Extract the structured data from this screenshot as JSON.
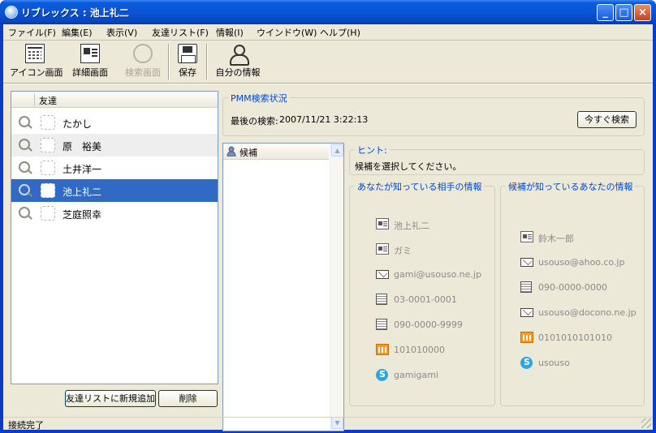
{
  "window": {
    "title": "リブレックス : 池上礼二",
    "min": "_",
    "max": "□",
    "close": "×"
  },
  "menu": [
    "ファイル(F)",
    "編集(E)",
    "表示(V)",
    "友達リスト(F)",
    "情報(I)",
    "ウインドウ(W)",
    "ヘルプ(H)"
  ],
  "toolbar": {
    "icon_view": "アイコン画面",
    "detail_view": "詳細画面",
    "search_view": "検索画面",
    "save": "保存",
    "my_info": "自分の情報"
  },
  "friends": {
    "header": "友達",
    "items": [
      "たかし",
      "原　裕美",
      "土井洋一",
      "池上礼二",
      "芝庭照幸"
    ],
    "selected_index": 3,
    "add_button": "友達リストに新規追加",
    "delete_button": "削除"
  },
  "pmm": {
    "title": "PMM検索状況",
    "last_search_label": "最後の検索:",
    "last_search_value": "2007/11/21 3:22:13",
    "search_now_button": "今すぐ検索"
  },
  "candidates": {
    "header": "候補"
  },
  "hint": {
    "title": "ヒント:",
    "text": "候補を選択してください。"
  },
  "known_about_partner": {
    "title": "あなたが知っている相手の情報",
    "items": [
      {
        "icon": "card-icon",
        "text": "池上礼二"
      },
      {
        "icon": "card-icon",
        "text": "ガミ"
      },
      {
        "icon": "mail-icon",
        "text": "gami@usouso.ne.jp"
      },
      {
        "icon": "phone-icon",
        "text": "03-0001-0001"
      },
      {
        "icon": "phone-icon",
        "text": "090-0000-9999"
      },
      {
        "icon": "pager-icon",
        "text": "101010000"
      },
      {
        "icon": "skype-icon",
        "text": "gamigami"
      }
    ]
  },
  "known_about_you": {
    "title": "候補が知っているあなたの情報",
    "items": [
      {
        "icon": "card-icon",
        "text": "鈴木一郎"
      },
      {
        "icon": "mail-icon",
        "text": "usouso@ahoo.co.jp"
      },
      {
        "icon": "phone-icon",
        "text": "090-0000-0000"
      },
      {
        "icon": "mail-icon",
        "text": "usouso@docono.ne.jp"
      },
      {
        "icon": "pager-icon",
        "text": "0101010101010"
      },
      {
        "icon": "skype-icon",
        "text": "usouso"
      }
    ]
  },
  "status": {
    "text": "接続完了"
  }
}
